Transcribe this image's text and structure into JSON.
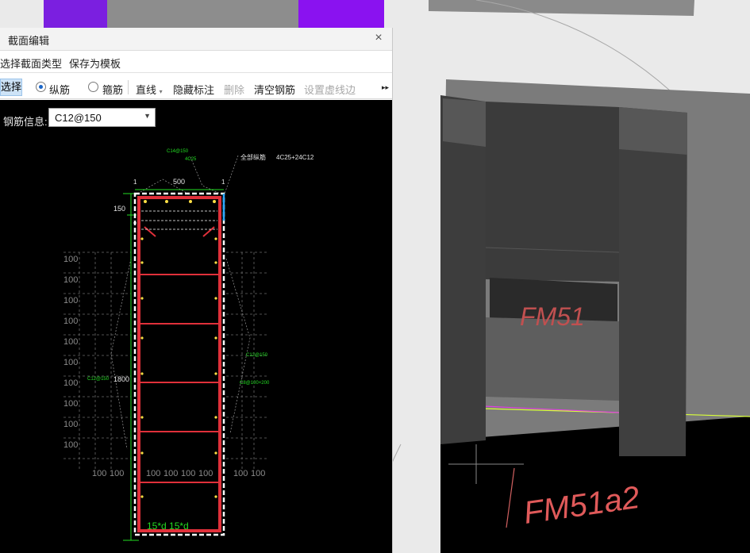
{
  "dialog": {
    "title": "截面编辑",
    "close_glyph": "×",
    "menu": [
      "选择截面类型",
      "保存为模板"
    ],
    "toolbar": {
      "select": "选择",
      "longitudinal": "纵筋",
      "stirrup": "箍筋",
      "line": "直线",
      "hide_labels": "隐藏标注",
      "delete": "删除",
      "clear_rebar": "清空钢筋",
      "set_dashed_edge": "设置虚线边",
      "more_glyph": "▸▸"
    },
    "rebar_info_label": "钢筋信息:",
    "rebar_info_value": "C12@150"
  },
  "drawing": {
    "width_dim": "500",
    "height_dim": "1800",
    "top_dim": "150",
    "one_left": "1",
    "one_right": "1",
    "all_long_label": "全部纵筋",
    "all_long_value": "4C25+24C12",
    "callout_a": "C14@150",
    "callout_b": "4C25",
    "side_left_callout": "C12@150",
    "side_right_callout_a": "C12@150",
    "side_right_callout_b": "C8@100×200",
    "grid_label": "100",
    "bottom_label": "15*d  15*d"
  },
  "scene": {
    "door_label": "FM51",
    "floor_label": "FM51a2"
  },
  "colors": {
    "rebar": "#e0303a",
    "dim": "#22dd22",
    "floor_edge": "#d9ff3a",
    "purple": "#7b1fe0"
  }
}
